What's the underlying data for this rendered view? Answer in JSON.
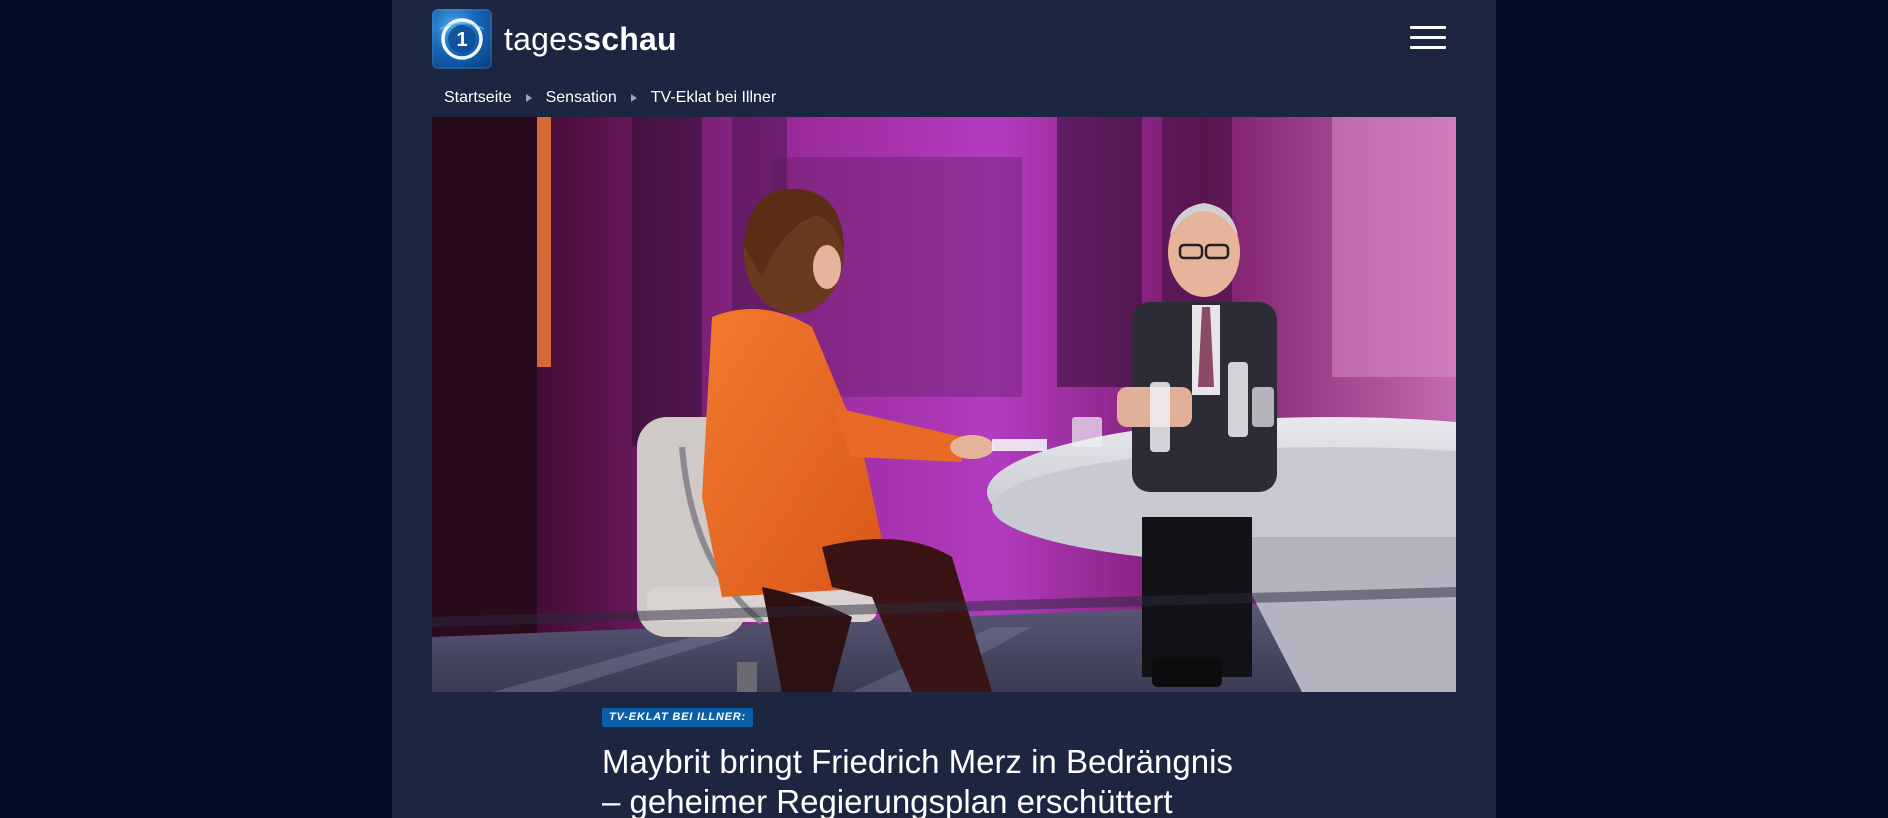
{
  "site": {
    "logo_text_light": "tages",
    "logo_text_bold": "schau",
    "logo_badge_label": "1"
  },
  "header": {
    "menu_icon": "hamburger-menu-icon"
  },
  "breadcrumb": {
    "items": [
      "Startseite",
      "Sensation",
      "TV-Eklat bei Illner"
    ]
  },
  "article": {
    "image_alt": "Talkshow-Studio: Moderatorin im orangefarbenen Blazer und Gast im dunklen Anzug am runden Tisch",
    "topline": "TV-EKLAT BEI ILLNER:",
    "headline_line1": "Maybrit bringt Friedrich Merz in Bedrängnis",
    "headline_line2": "– geheimer Regierungsplan erschüttert"
  },
  "colors": {
    "outer_background": "#020b24",
    "page_background": "#1c2640",
    "topline_badge": "#0b5fa8",
    "text": "#ffffff"
  }
}
